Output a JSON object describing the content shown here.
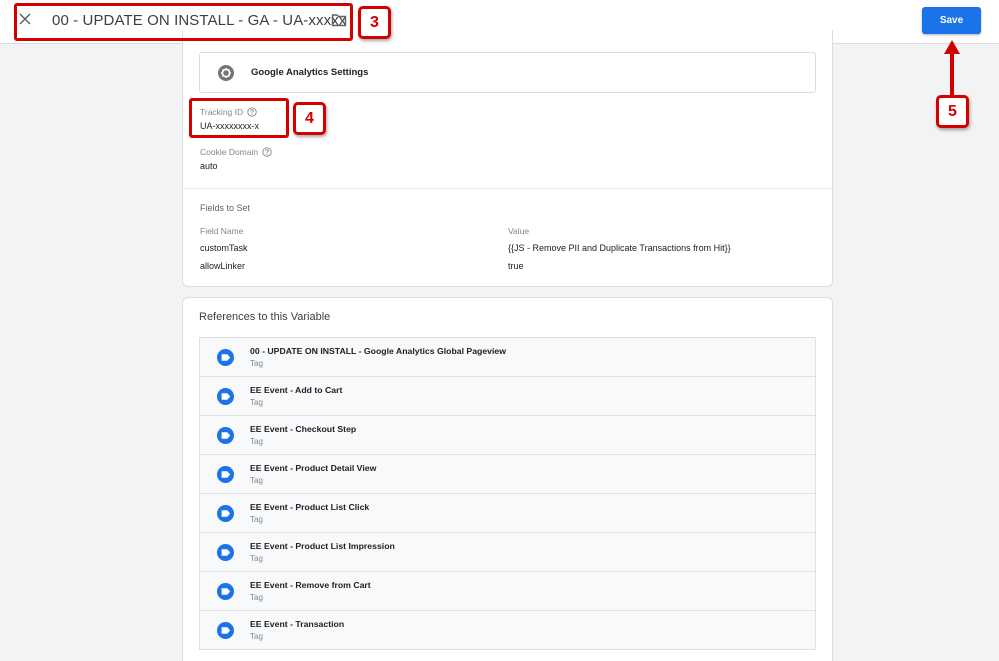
{
  "header": {
    "title": "00 - UPDATE ON INSTALL - GA - UA-xxxxx",
    "save_label": "Save",
    "close_icon": "close-icon",
    "folder_icon": "folder-icon"
  },
  "annotations": {
    "title_step": "3",
    "tracking_step": "4",
    "save_step": "5",
    "color": "#d40000"
  },
  "settings": {
    "variable_label": "Google Analytics Settings",
    "tracking_id_label": "Tracking ID",
    "tracking_id_value": "UA-xxxxxxxx-x",
    "cookie_domain_label": "Cookie Domain",
    "cookie_domain_value": "auto",
    "fields_to_set_title": "Fields to Set",
    "fields_columns": [
      "Field Name",
      "Value"
    ],
    "fields": [
      {
        "name": "customTask",
        "value": "{{JS - Remove PII and Duplicate Transactions from Hit}}"
      },
      {
        "name": "allowLinker",
        "value": "true"
      }
    ]
  },
  "references": {
    "title": "References to this Variable",
    "items": [
      {
        "name": "00 - UPDATE ON INSTALL - Google Analytics Global Pageview",
        "type": "Tag"
      },
      {
        "name": "EE Event - Add to Cart",
        "type": "Tag"
      },
      {
        "name": "EE Event - Checkout Step",
        "type": "Tag"
      },
      {
        "name": "EE Event - Product Detail View",
        "type": "Tag"
      },
      {
        "name": "EE Event - Product List Click",
        "type": "Tag"
      },
      {
        "name": "EE Event - Product List Impression",
        "type": "Tag"
      },
      {
        "name": "EE Event - Remove from Cart",
        "type": "Tag"
      },
      {
        "name": "EE Event - Transaction",
        "type": "Tag"
      }
    ]
  },
  "colors": {
    "primary": "#1a73e8",
    "background": "#f1f3f4"
  }
}
